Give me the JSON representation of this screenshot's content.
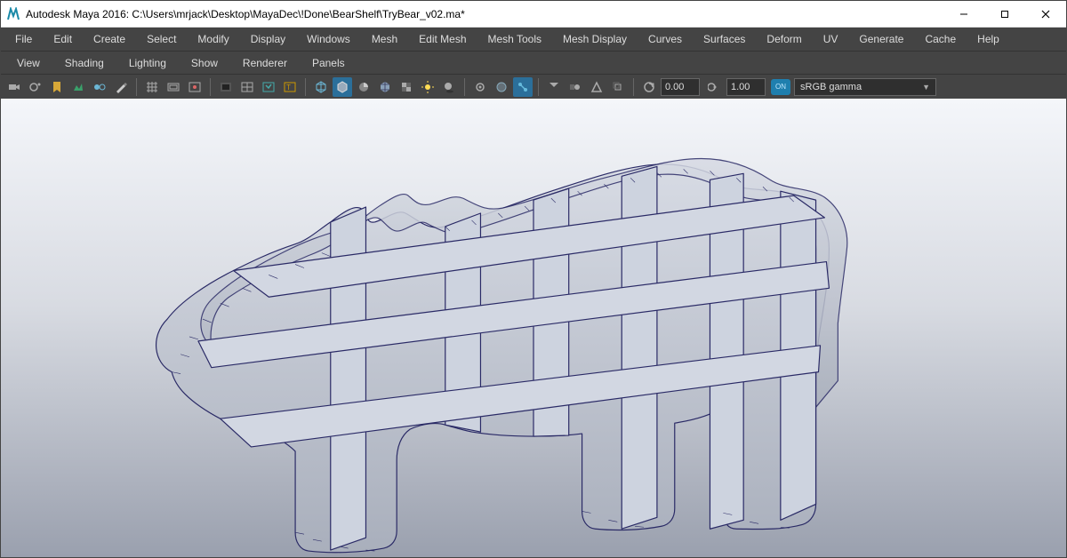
{
  "titlebar": {
    "text": "Autodesk Maya 2016: C:\\Users\\mrjack\\Desktop\\MayaDec\\!Done\\BearShelf\\TryBear_v02.ma*"
  },
  "menubar": {
    "items": [
      "File",
      "Edit",
      "Create",
      "Select",
      "Modify",
      "Display",
      "Windows",
      "Mesh",
      "Edit Mesh",
      "Mesh Tools",
      "Mesh Display",
      "Curves",
      "Surfaces",
      "Deform",
      "UV",
      "Generate",
      "Cache",
      "Help"
    ]
  },
  "panelbar": {
    "items": [
      "View",
      "Shading",
      "Lighting",
      "Show",
      "Renderer",
      "Panels"
    ]
  },
  "toolbar": {
    "field_near": "0.00",
    "field_far": "1.00",
    "color_badge": "ON",
    "gamma_label": "sRGB gamma"
  },
  "icons": {
    "select": "select-icon",
    "camera": "camera-icon",
    "bookmark": "bookmark-icon",
    "texture": "texture-icon",
    "wire": "wireframe-icon",
    "shade": "shaded-icon",
    "light": "light-icon",
    "grid": "grid-icon",
    "resolution": "resolution-gate-icon",
    "film": "film-gate-icon",
    "title": "title-safe-icon",
    "isolate": "isolate-icon",
    "xray": "xray-icon",
    "cube": "cube-icon",
    "joint": "joint-icon",
    "sphere": "sphere-icon",
    "sun": "sun-icon",
    "cloud": "cloud-icon",
    "dof": "dof-icon",
    "motion": "motion-blur-icon",
    "arrow": "arrow-icon",
    "snap": "snap-icon",
    "gate": "gate-icon",
    "expose": "exposure-icon",
    "gamma": "gamma-icon"
  }
}
